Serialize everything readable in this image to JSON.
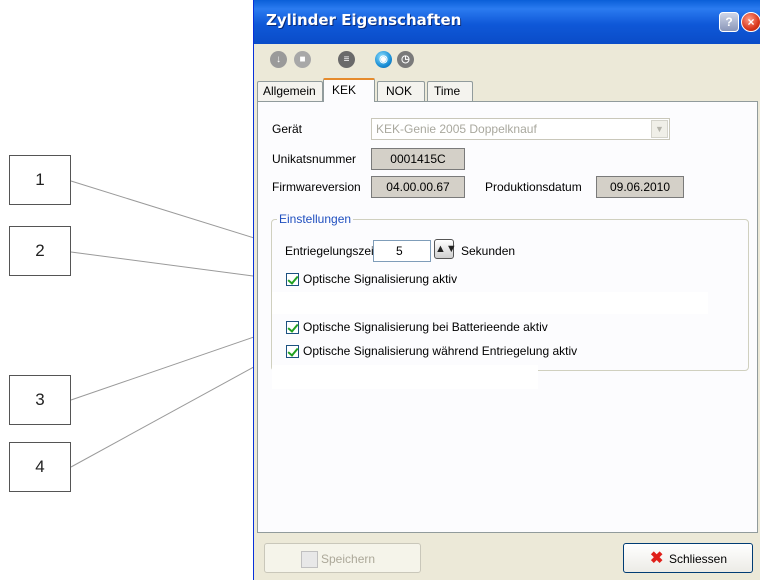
{
  "callouts": [
    "1",
    "2",
    "3",
    "4"
  ],
  "window": {
    "title": "Zylinder Eigenschaften",
    "title_buttons": [
      "help-icon",
      "close-icon"
    ]
  },
  "toolbar": {
    "icons": [
      "download-icon",
      "stop-icon",
      "list-icon",
      "connect-icon",
      "clock-icon"
    ]
  },
  "tabs": [
    {
      "label": "Allgemein",
      "active": false
    },
    {
      "label": "KEK",
      "active": true
    },
    {
      "label": "NOK",
      "active": false
    },
    {
      "label": "Time",
      "active": false
    }
  ],
  "device": {
    "geraet_label": "Gerät",
    "geraet_value": "KEK-Genie 2005 Doppelknauf",
    "unikat_label": "Unikatsnummer",
    "unikat_value": "0001415C",
    "firmware_label": "Firmwareversion",
    "firmware_value": "04.00.00.67",
    "produktion_label": "Produktionsdatum",
    "produktion_value": "09.06.2010"
  },
  "settings": {
    "group_title": "Einstellungen",
    "entriegelung_label": "Entriegelungszeit",
    "entriegelung_value": "5",
    "entriegelung_unit": "Sekunden",
    "checkboxes": [
      {
        "label": "Optische Signalisierung aktiv",
        "checked": true
      },
      {
        "label": "Optische Signalisierung bei Batterieende aktiv",
        "checked": true
      },
      {
        "label": "Optische Signalisierung während Entriegelung aktiv",
        "checked": true
      }
    ]
  },
  "footer": {
    "save_label": "Speichern",
    "save_enabled": false,
    "close_label": "Schliessen"
  },
  "colors": {
    "titlebar": "#0a5fd8",
    "active_tab_accent": "#e68b2c",
    "group_title": "#1f4fbf",
    "checkmark": "#21a121",
    "close_x": "#e0201a"
  }
}
